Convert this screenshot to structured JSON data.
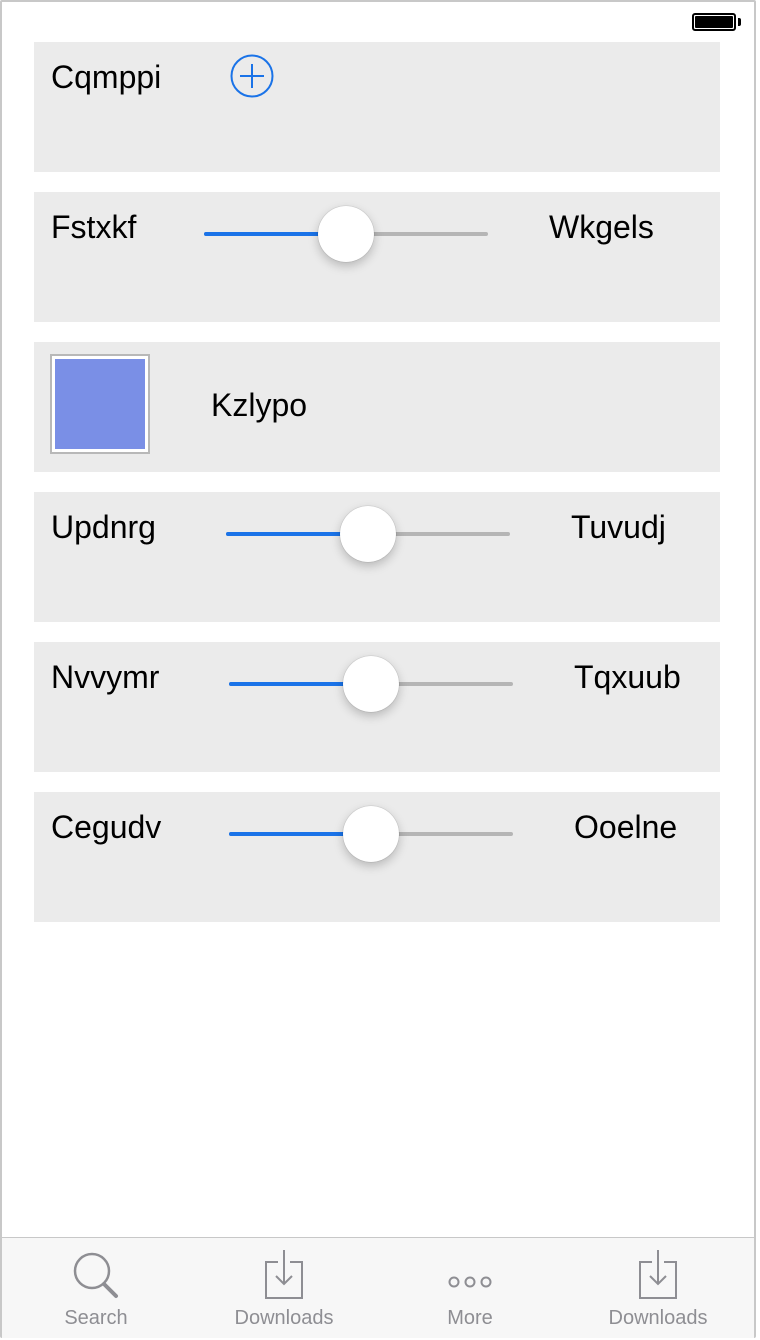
{
  "accent_color": "#1a73e8",
  "status_bar": {
    "battery_icon": "battery-full-icon"
  },
  "rows": {
    "stepper": {
      "label": "Cqmppi",
      "icon": "add-circle-icon"
    },
    "slider1": {
      "label": "Fstxkf",
      "value_label": "Wkgels",
      "value": 0.5
    },
    "color": {
      "label": "Kzlypo",
      "swatch_color": "#7a8fe6"
    },
    "slider2": {
      "label": "Updnrg",
      "value_label": "Tuvudj",
      "value": 0.5
    },
    "slider3": {
      "label": "Nvvymr",
      "value_label": "Tqxuub",
      "value": 0.5
    },
    "slider4": {
      "label": "Cegudv",
      "value_label": "Ooelne",
      "value": 0.5
    }
  },
  "tab_bar": {
    "tabs": [
      {
        "label": "Search",
        "icon": "search-icon"
      },
      {
        "label": "Downloads",
        "icon": "download-icon"
      },
      {
        "label": "More",
        "icon": "more-icon"
      },
      {
        "label": "Downloads",
        "icon": "download-icon"
      }
    ]
  }
}
